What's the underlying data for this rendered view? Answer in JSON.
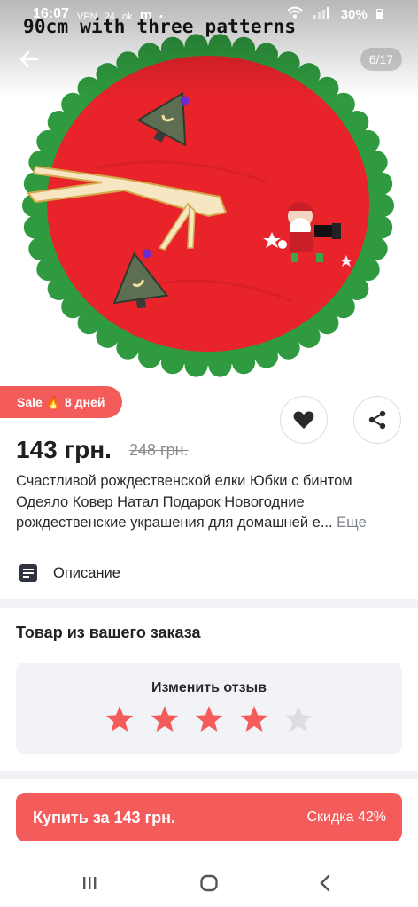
{
  "status_bar": {
    "time": "16:07",
    "left_icons": [
      "VPN",
      "24",
      "ok",
      "m",
      "•"
    ],
    "battery": "30%"
  },
  "hero": {
    "overlay_text": "90cm with three patterns",
    "page_counter": "6/17"
  },
  "colors": {
    "accent": "#f45b5b",
    "skirt_red": "#e8232a",
    "skirt_green": "#2f9a3f",
    "star_filled": "#f45b5b",
    "star_empty": "#dcdde3"
  },
  "product": {
    "sale_badge": "Sale 🔥 8 дней",
    "price": "143 грн.",
    "old_price": "248 грн.",
    "description_lines": [
      "Счастливой рождественской елки Юбки с бинтом",
      "Одеяло Ковер Натал Подарок Новогодние",
      "рождественские украшения для домашней е..."
    ],
    "more_label": "Еще",
    "description_label": "Описание"
  },
  "order": {
    "title": "Товар из вашего заказа",
    "review_label": "Изменить отзыв",
    "rating": 4,
    "max_rating": 5
  },
  "buy": {
    "label": "Купить за 143 грн.",
    "discount": "Скидка 42%"
  },
  "icons": {
    "back": "arrow-left-icon",
    "favorite": "heart-icon",
    "share": "share-icon",
    "description": "document-icon",
    "nav_recent": "recent-apps-icon",
    "nav_home": "home-icon",
    "nav_back": "chevron-left-icon"
  }
}
